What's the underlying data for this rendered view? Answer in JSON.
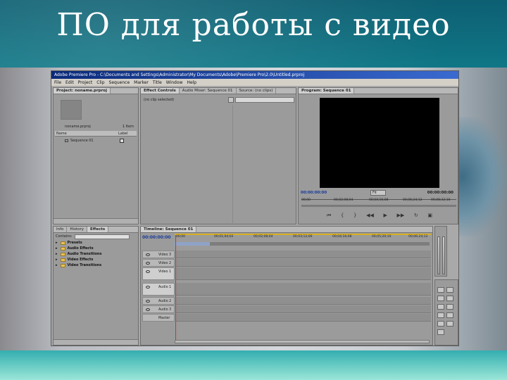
{
  "slide": {
    "title": "ПО для работы с видео"
  },
  "app": {
    "window_title": "Adobe Premiere Pro - C:\\Documents and Settings\\Administrator\\My Documents\\Adobe\\Premiere Pro\\2.0\\Untitled.prproj",
    "menu": [
      "File",
      "Edit",
      "Project",
      "Clip",
      "Sequence",
      "Marker",
      "Title",
      "Window",
      "Help"
    ]
  },
  "project_panel": {
    "tab": "Project: noname.prproj",
    "file_name": "noname.prproj",
    "item_count": "1 Item",
    "col_name": "Name",
    "col_label": "Label",
    "rows": [
      {
        "name": "Sequence 01"
      }
    ]
  },
  "effect_controls": {
    "tabs": [
      "Effect Controls",
      "Audio Mixer: Sequence 01",
      "Source: (no clips)"
    ],
    "no_clip": "(no clip selected)"
  },
  "program_monitor": {
    "tab": "Program: Sequence 01",
    "timecode_left": "00:00:00:00",
    "timecode_right": "00:00:00:00",
    "fit": "Fit",
    "ruler": [
      "00;00",
      "00;02;08;04",
      "00;04;16;08",
      "00;06;24;12",
      "00;08;32;16"
    ]
  },
  "effects_panel": {
    "tabs": [
      "Info",
      "History",
      "Effects"
    ],
    "contains_label": "Contains:",
    "folders": [
      "Presets",
      "Audio Effects",
      "Audio Transitions",
      "Video Effects",
      "Video Transitions"
    ]
  },
  "timeline": {
    "tab": "Timeline: Sequence 01",
    "timecode": "00:00:00:00",
    "ruler": [
      "00;00",
      "00;01;04;02",
      "00;02;08;04",
      "00;03;12;06",
      "00;04;16;08",
      "00;05;20;10",
      "00;06;24;12"
    ],
    "video_tracks": [
      "Video 3",
      "Video 2",
      "Video 1"
    ],
    "audio_tracks": [
      "Audio 1",
      "Audio 2",
      "Audio 3",
      "Master"
    ]
  }
}
